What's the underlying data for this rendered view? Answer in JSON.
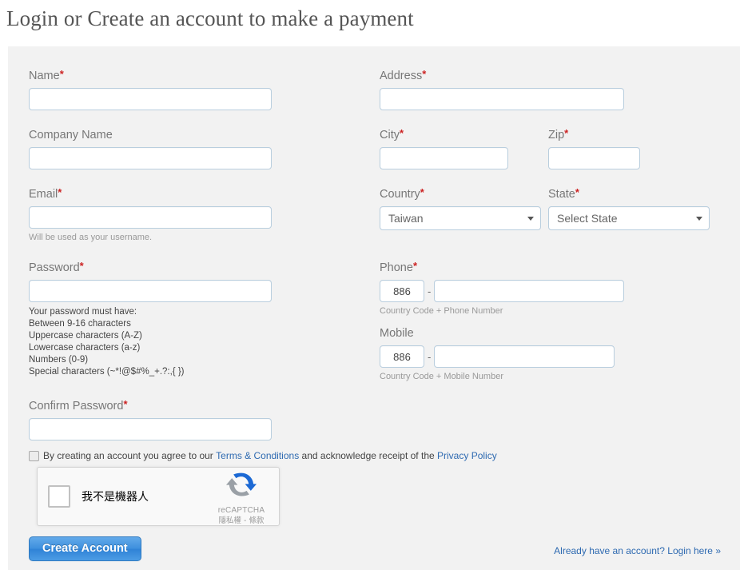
{
  "page": {
    "title": "Login or Create an account to make a payment"
  },
  "form": {
    "left": {
      "name": {
        "label": "Name",
        "required": true,
        "value": "",
        "placeholder": ""
      },
      "company": {
        "label": "Company Name",
        "required": false,
        "value": "",
        "placeholder": ""
      },
      "email": {
        "label": "Email",
        "required": true,
        "value": "",
        "placeholder": "",
        "hint": "Will be used as your username."
      },
      "password": {
        "label": "Password",
        "required": true,
        "value": "",
        "placeholder": "",
        "rules_title": "Your password must have:",
        "rules": [
          "Between 9-16 characters",
          "Uppercase characters (A-Z)",
          "Lowercase characters (a-z)",
          "Numbers (0-9)",
          "Special characters (~*!@$#%_+.?:,{ })"
        ]
      },
      "confirm_password": {
        "label": "Confirm Password",
        "required": true,
        "value": "",
        "placeholder": ""
      }
    },
    "right": {
      "address": {
        "label": "Address",
        "required": true,
        "value": "",
        "placeholder": ""
      },
      "city": {
        "label": "City",
        "required": true,
        "value": "",
        "placeholder": ""
      },
      "zip": {
        "label": "Zip",
        "required": true,
        "value": "",
        "placeholder": ""
      },
      "country": {
        "label": "Country",
        "required": true,
        "selected": "Taiwan"
      },
      "state": {
        "label": "State",
        "required": true,
        "selected": "Select State"
      },
      "phone": {
        "label": "Phone",
        "required": true,
        "country_code": "886",
        "separator": "-",
        "number": "",
        "hint": "Country Code + Phone Number"
      },
      "mobile": {
        "label": "Mobile",
        "required": false,
        "country_code": "886",
        "separator": "-",
        "number": "",
        "hint": "Country Code + Mobile Number"
      }
    },
    "terms": {
      "checked": false,
      "text_before": "By creating an account you agree to our",
      "link_terms": "Terms & Conditions",
      "text_middle": "and acknowledge receipt of the",
      "link_privacy": "Privacy Policy"
    },
    "recaptcha": {
      "checked": false,
      "label": "我不是機器人",
      "brand": "reCAPTCHA",
      "legal": "隱私權 - 條款"
    },
    "submit_label": "Create Account",
    "login_link": "Already have an account? Login here »"
  },
  "colors": {
    "page_bg": "#ffffff",
    "panel_bg": "#f2f2f2",
    "label": "#777777",
    "required_asterisk": "#cc2222",
    "input_border": "#b9cede",
    "link": "#2e6ab1",
    "button": "#3d8fdd",
    "title": "#555555"
  }
}
